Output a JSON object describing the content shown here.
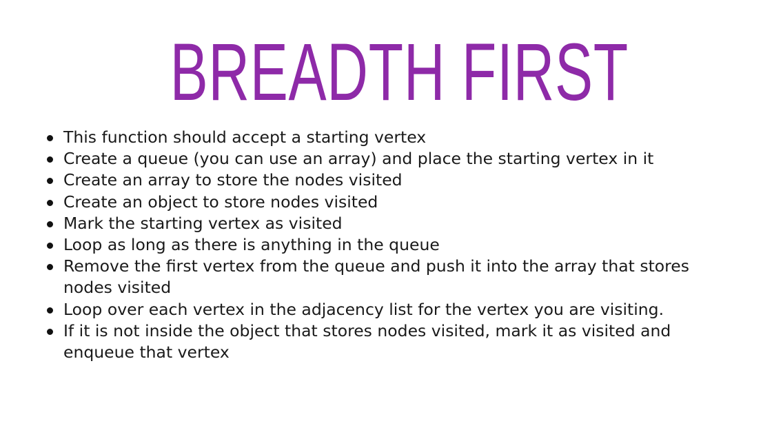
{
  "slide": {
    "title": "BREADTH FIRST",
    "title_color": "#8e2aa8",
    "bullets": [
      "This function should accept a starting vertex",
      "Create a queue (you can use an array) and place the starting vertex in it",
      "Create an array to store the nodes visited",
      "Create an object to store nodes visited",
      "Mark the starting vertex as visited",
      "Loop as long as there is anything in the queue",
      "Remove the first vertex from the queue and push it into the array that stores nodes visited",
      "Loop over each vertex in the adjacency list for the vertex you are visiting.",
      "If it is not inside the object that stores nodes visited, mark it as visited and enqueue that vertex"
    ]
  }
}
